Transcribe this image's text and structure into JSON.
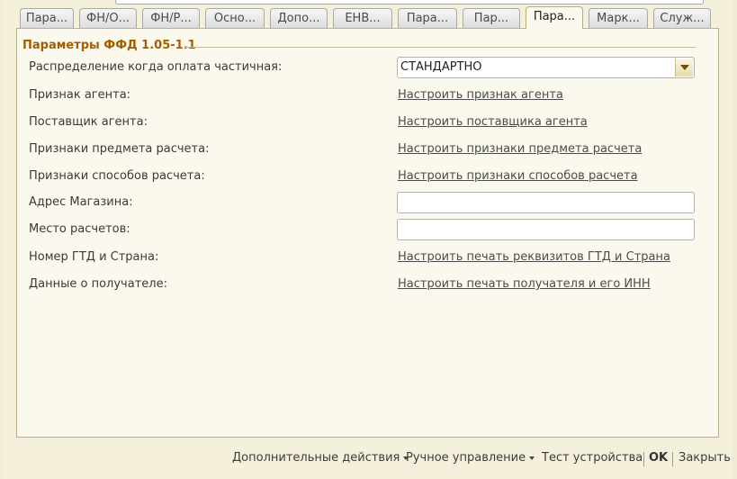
{
  "tabs": [
    {
      "label": "Пара..."
    },
    {
      "label": "ФН/О..."
    },
    {
      "label": "ФН/Р..."
    },
    {
      "label": "Осно..."
    },
    {
      "label": "Допо..."
    },
    {
      "label": "ЕНВ..."
    },
    {
      "label": "Пара..."
    },
    {
      "label": "Пар..."
    },
    {
      "label": "Пара...",
      "active": true
    },
    {
      "label": "Марк..."
    },
    {
      "label": "Служ..."
    }
  ],
  "group": {
    "title": "Параметры ФФД 1.05-1.1"
  },
  "rows": [
    {
      "label": "Распределение когда оплата частичная:",
      "select_value": "СТАНДАРТНО"
    },
    {
      "label": "Признак агента:",
      "link": "Настроить признак агента"
    },
    {
      "label": "Поставщик агента:",
      "link": "Настроить поставщика агента"
    },
    {
      "label": "Признаки предмета расчета:",
      "link": "Настроить признаки предмета расчета"
    },
    {
      "label": "Признаки способов расчета:",
      "link": "Настроить признаки способов расчета"
    },
    {
      "label": "Адрес Магазина:",
      "input_value": ""
    },
    {
      "label": "Место расчетов:",
      "input_value": ""
    },
    {
      "label": "Номер ГТД и Страна:",
      "link": "Настроить печать реквизитов ГТД и Страна"
    },
    {
      "label": "Данные о получателе:",
      "link": "Настроить печать получателя и его ИНН"
    }
  ],
  "bottom": {
    "additional_actions": "Дополнительные действия",
    "manual_control": "Ручное управление",
    "test_device": "Тест устройства",
    "ok": "OK",
    "close": "Закрыть"
  }
}
